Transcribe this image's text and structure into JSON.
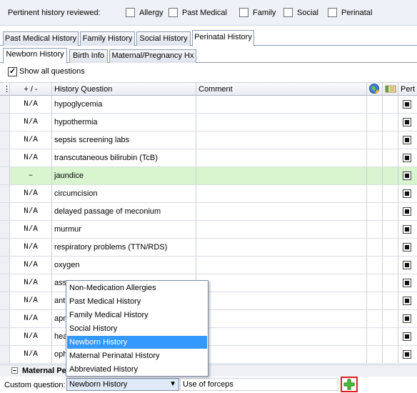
{
  "reviewed": {
    "label": "Pertinent history reviewed:",
    "options": [
      {
        "label": "Allergy",
        "checked": false
      },
      {
        "label": "Past Medical",
        "checked": false
      },
      {
        "label": "Family",
        "checked": false
      },
      {
        "label": "Social",
        "checked": false
      },
      {
        "label": "Perinatal",
        "checked": false
      }
    ]
  },
  "tabs": [
    {
      "label": "Past Medical History",
      "active": false
    },
    {
      "label": "Family History",
      "active": false
    },
    {
      "label": "Social History",
      "active": false
    },
    {
      "label": "Perinatal History",
      "active": true
    }
  ],
  "subtabs": [
    {
      "label": "Newborn History",
      "active": true
    },
    {
      "label": "Birth Info",
      "active": false
    },
    {
      "label": "Maternal/Pregnancy Hx",
      "active": false
    }
  ],
  "show_all": {
    "label": "Show all questions",
    "checked": true
  },
  "grid": {
    "columns": {
      "plusminus": "+ / -",
      "question": "History Question",
      "comment": "Comment",
      "pertinent": "Pert"
    },
    "rows": [
      {
        "pm": "N/A",
        "question": "hypoglycemia",
        "highlighted": false
      },
      {
        "pm": "N/A",
        "question": "hypothermia",
        "highlighted": false
      },
      {
        "pm": "N/A",
        "question": "sepsis screening labs",
        "highlighted": false
      },
      {
        "pm": "N/A",
        "question": "transcutaneous bilirubin (TcB)",
        "highlighted": false
      },
      {
        "pm": "–",
        "question": "jaundice",
        "highlighted": true
      },
      {
        "pm": "N/A",
        "question": "circumcision",
        "highlighted": false
      },
      {
        "pm": "N/A",
        "question": "delayed passage of meconium",
        "highlighted": false
      },
      {
        "pm": "N/A",
        "question": "murmur",
        "highlighted": false
      },
      {
        "pm": "N/A",
        "question": "respiratory problems (TTN/RDS)",
        "highlighted": false
      },
      {
        "pm": "N/A",
        "question": "oxygen",
        "highlighted": false
      },
      {
        "pm": "N/A",
        "question": "ass",
        "highlighted": false
      },
      {
        "pm": "N/A",
        "question": "ant",
        "highlighted": false
      },
      {
        "pm": "N/A",
        "question": "apn",
        "highlighted": false
      },
      {
        "pm": "N/A",
        "question": "hea",
        "highlighted": false
      },
      {
        "pm": "N/A",
        "question": "oph",
        "highlighted": false
      }
    ]
  },
  "dropdown": {
    "items": [
      "Non-Medication Allergies",
      "Past Medical History",
      "Family Medical History",
      "Social History",
      "Newborn History",
      "Maternal Perinatal History",
      "Abbreviated History"
    ],
    "selected_index": 4
  },
  "maternal_section": {
    "label": "Maternal Pe"
  },
  "custom_question": {
    "label": "Custom question:",
    "selected": "Newborn History",
    "input_value": "Use of forceps"
  }
}
